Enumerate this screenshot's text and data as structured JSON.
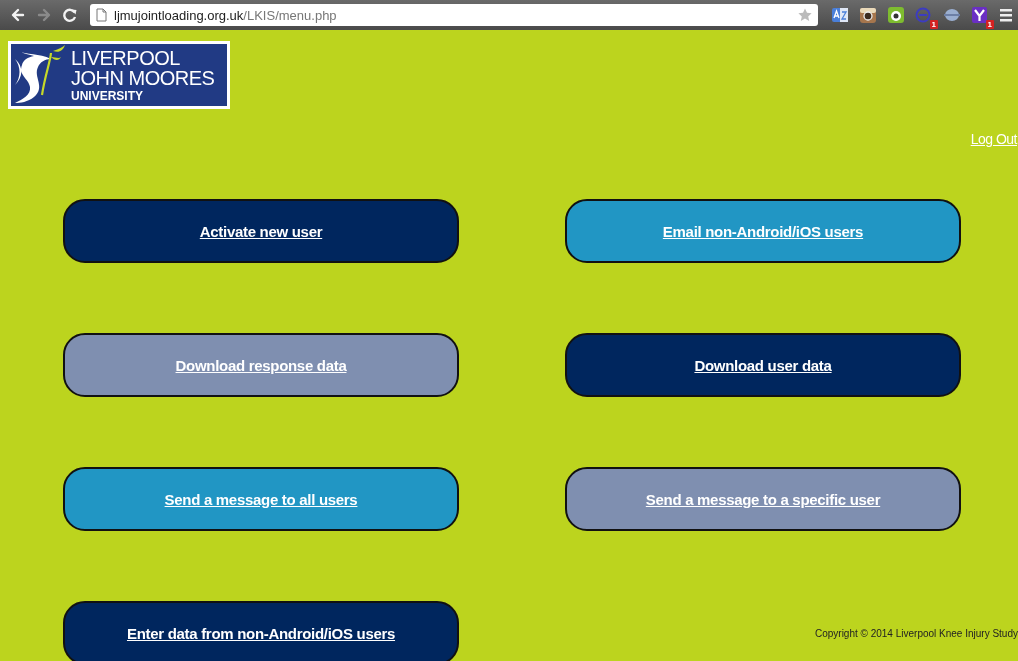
{
  "browser": {
    "nav": [
      {
        "kind": "back",
        "disabled": false
      },
      {
        "kind": "forward",
        "disabled": true
      },
      {
        "kind": "reload",
        "disabled": false
      }
    ],
    "url_host": "ljmujointloading.org.uk",
    "url_path": "/LKIS/menu.php",
    "bookmarked": false,
    "extensions": [
      {
        "kind": "translate"
      },
      {
        "kind": "camera"
      },
      {
        "kind": "eye"
      },
      {
        "kind": "e",
        "badge": "1"
      },
      {
        "kind": "globe"
      },
      {
        "kind": "y",
        "badge": "1"
      }
    ]
  },
  "logo": {
    "lines": [
      "LIVERPOOL",
      "JOHN MOORES",
      "UNIVERSITY"
    ]
  },
  "logout": "Log Out",
  "buttons": [
    {
      "label": "Activate new user",
      "color": "#00265e"
    },
    {
      "label": "Email non-Android/iOS users",
      "color": "#2196c4"
    },
    {
      "label": "Download response data",
      "color": "#7f8fb0"
    },
    {
      "label": "Download user data",
      "color": "#00265e"
    },
    {
      "label": "Send a message to all users",
      "color": "#2196c4"
    },
    {
      "label": "Send a message to a specific user",
      "color": "#7f8fb0"
    },
    {
      "label": "Enter data from non-Android/iOS users",
      "color": "#00265e"
    }
  ],
  "footer": "Copyright © 2014 Liverpool Knee Injury Study"
}
